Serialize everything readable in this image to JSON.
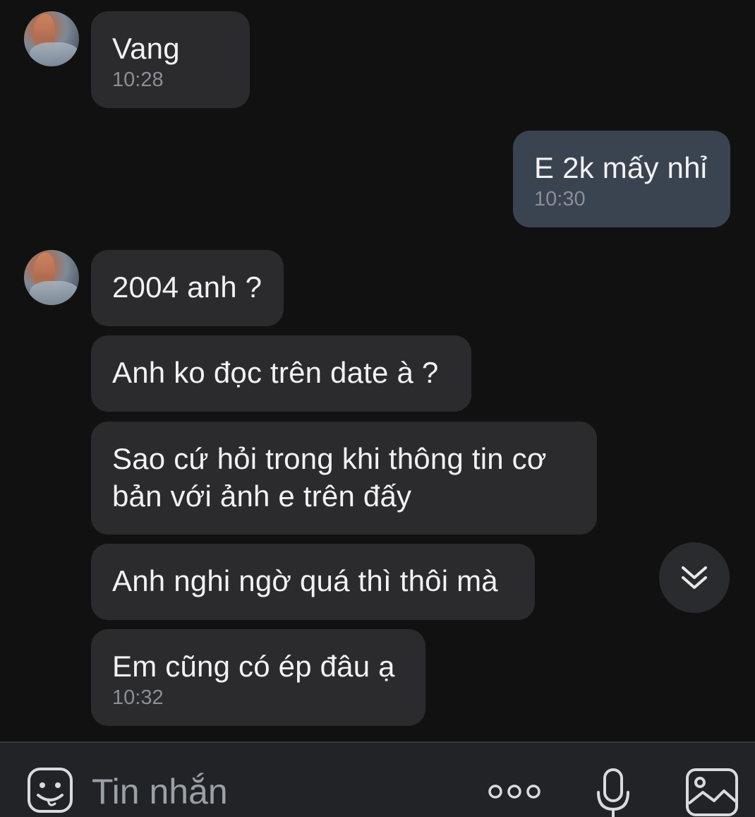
{
  "messages": [
    {
      "sender": "other",
      "text": "Vang",
      "time": "10:28"
    },
    {
      "sender": "me",
      "text": "E 2k mấy nhỉ",
      "time": "10:30"
    },
    {
      "sender": "other",
      "text": "2004 anh ?"
    },
    {
      "sender": "other",
      "text": "Anh ko đọc trên date à ?"
    },
    {
      "sender": "other",
      "lines": [
        "Sao cứ hỏi trong khi thông tin cơ",
        "bản với ảnh e trên đấy"
      ]
    },
    {
      "sender": "other",
      "text": "Anh nghi ngờ quá thì thôi mà"
    },
    {
      "sender": "other",
      "text": "Em cũng có ép đâu ạ",
      "time": "10:32"
    }
  ],
  "composer": {
    "placeholder": "Tin nhắn",
    "icons": [
      "sticker-icon",
      "more-icon",
      "microphone-icon",
      "image-icon"
    ]
  },
  "scroll_button": {
    "icon": "double-chevron-down-icon"
  },
  "colors": {
    "background": "#111112",
    "incoming_bubble": "#2b2b2d",
    "outgoing_bubble": "#3a4350",
    "text": "#f2f2f2",
    "timestamp": "#8a8f96",
    "composer_bg": "#222326"
  }
}
